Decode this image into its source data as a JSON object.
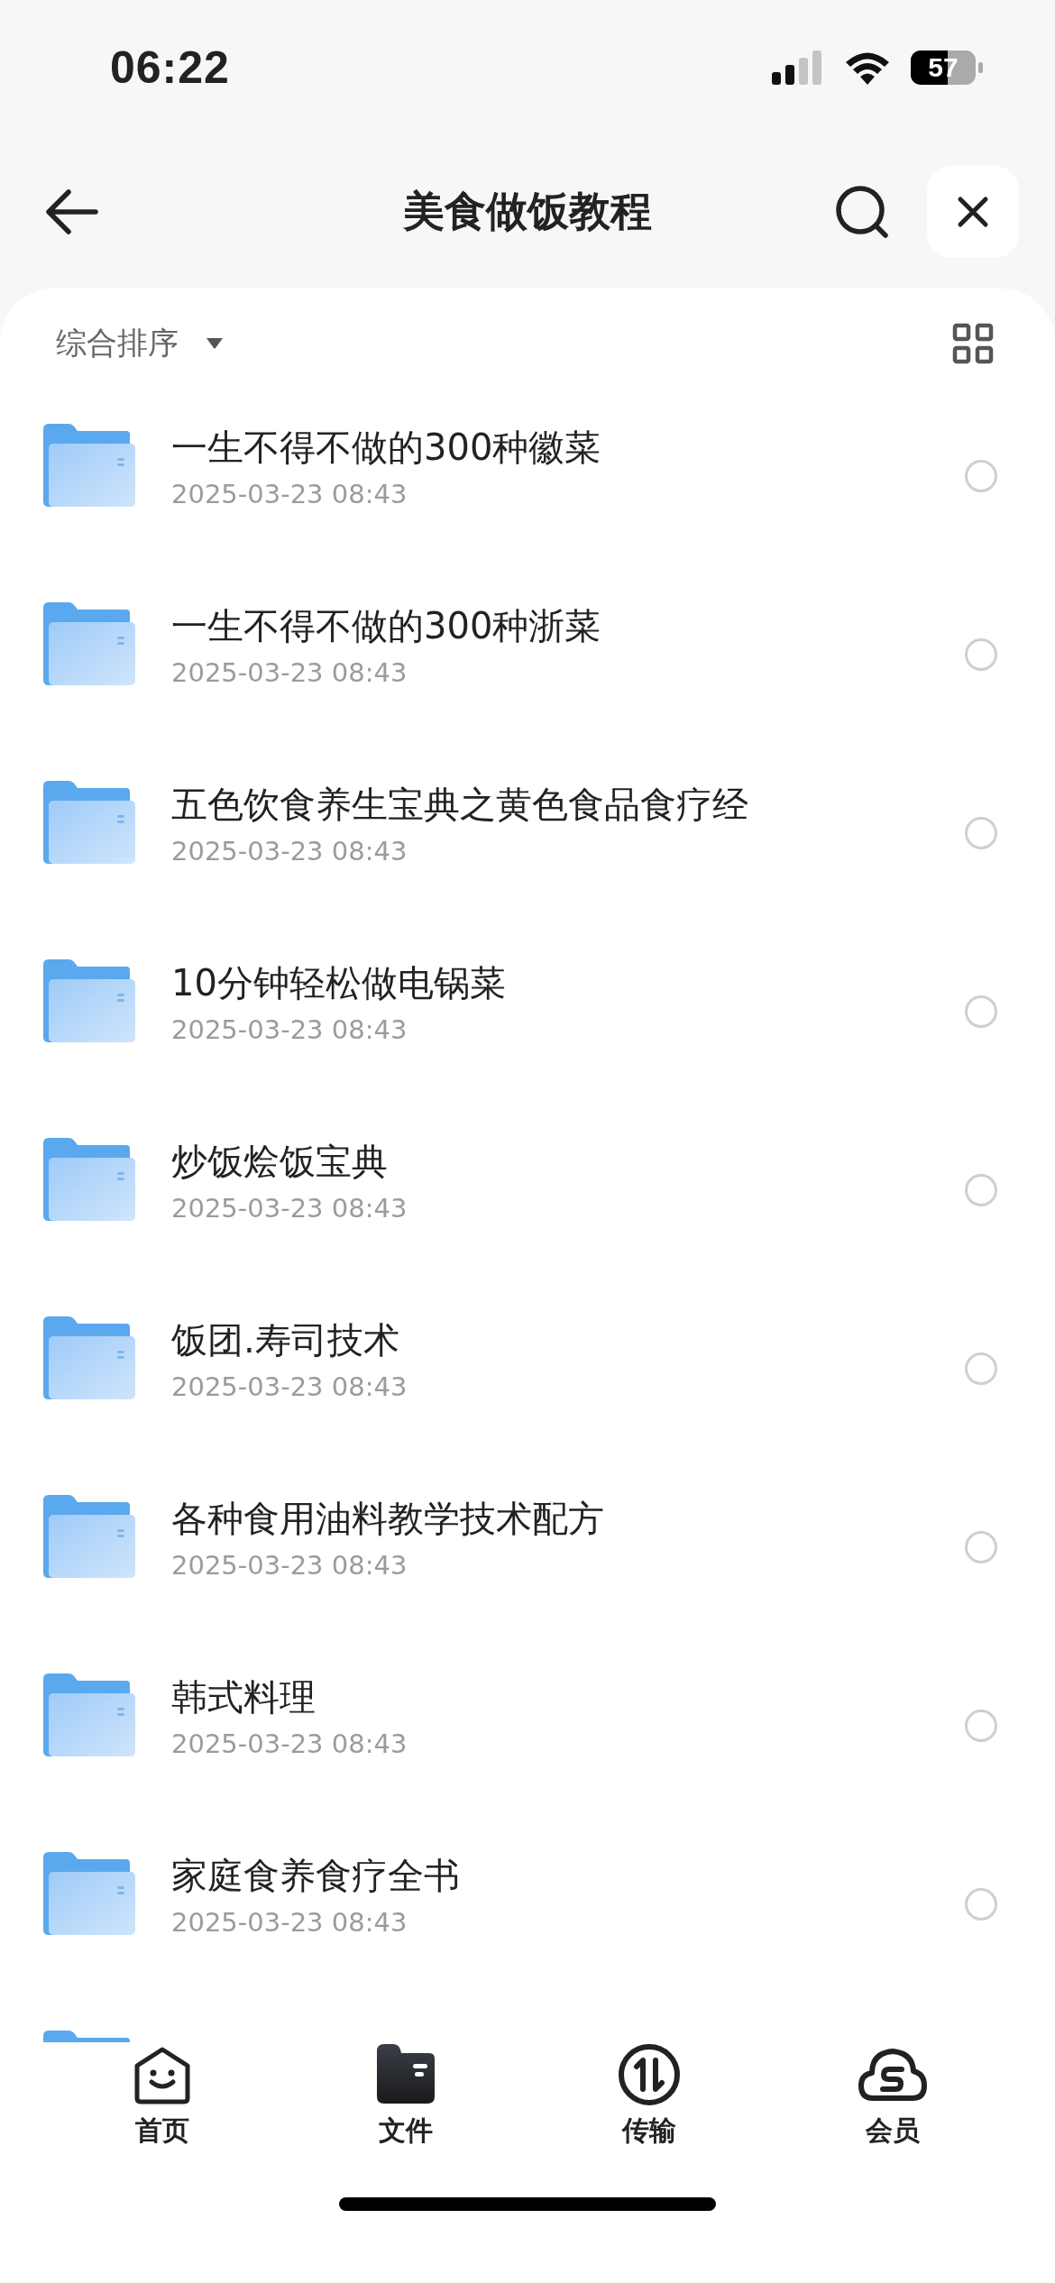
{
  "status_bar": {
    "time": "06:22",
    "battery": "57"
  },
  "header": {
    "title": "美食做饭教程"
  },
  "toolbar": {
    "sort_label": "综合排序"
  },
  "files": [
    {
      "kind": "folder",
      "name": "一生不得不做的300种徽菜",
      "date": "2025-03-23 08:43",
      "checked": false
    },
    {
      "kind": "folder",
      "name": "一生不得不做的300种浙菜",
      "date": "2025-03-23 08:43",
      "checked": false
    },
    {
      "kind": "folder",
      "name": "五色饮食养生宝典之黄色食品食疗经",
      "date": "2025-03-23 08:43",
      "checked": false
    },
    {
      "kind": "folder",
      "name": "10分钟轻松做电锅菜",
      "date": "2025-03-23 08:43",
      "checked": false
    },
    {
      "kind": "folder",
      "name": "炒饭烩饭宝典",
      "date": "2025-03-23 08:43",
      "checked": false
    },
    {
      "kind": "folder",
      "name": "饭团.寿司技术",
      "date": "2025-03-23 08:43",
      "checked": false
    },
    {
      "kind": "folder",
      "name": "各种食用油料教学技术配方",
      "date": "2025-03-23 08:43",
      "checked": false
    },
    {
      "kind": "folder",
      "name": "韩式料理",
      "date": "2025-03-23 08:43",
      "checked": false
    },
    {
      "kind": "folder",
      "name": "家庭食养食疗全书",
      "date": "2025-03-23 08:43",
      "checked": false
    },
    {
      "kind": "partial_folder"
    }
  ],
  "tab_bar": [
    {
      "label": "首页",
      "selected": false
    },
    {
      "label": "文件",
      "selected": true
    },
    {
      "label": "传输",
      "selected": false
    },
    {
      "label": "会员",
      "selected": false
    }
  ]
}
